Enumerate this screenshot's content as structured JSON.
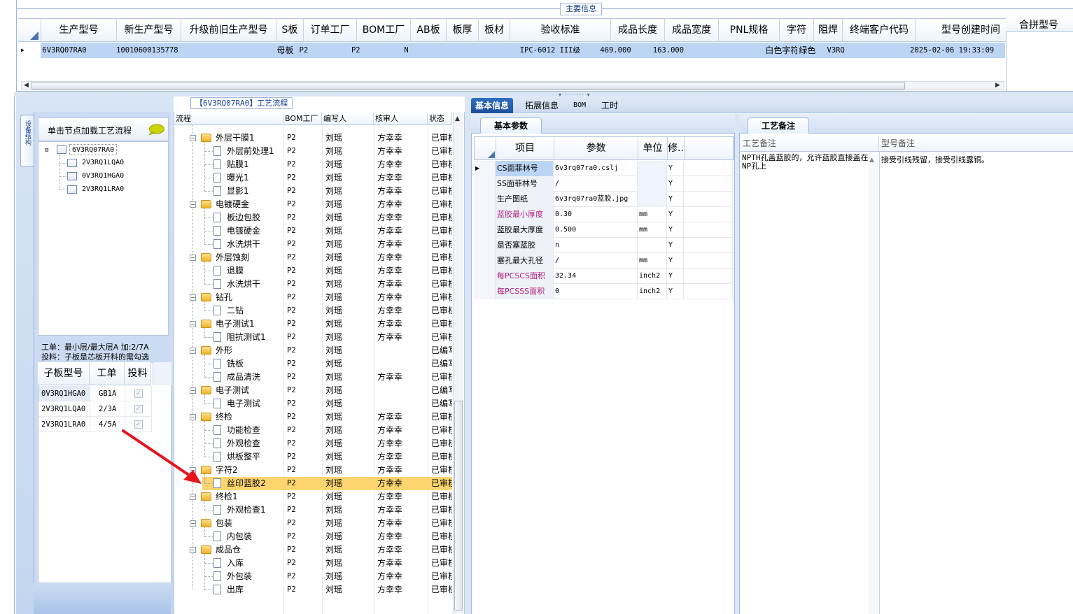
{
  "top": {
    "title": "主要信息",
    "columns": [
      "生产型号",
      "新生产型号",
      "升级前旧生产型号",
      "S板",
      "订单工厂",
      "BOM工厂",
      "AB板",
      "板厚",
      "板材",
      "验收标准",
      "成品长度",
      "成品宽度",
      "PNL规格",
      "字符",
      "阻焊",
      "终端客户代码",
      "型号创建时间"
    ],
    "merge_column": "合拼型号",
    "row": [
      "6V3RQ07RA0",
      "10010600135778",
      "",
      "母板",
      "P2",
      "P2",
      "N",
      "",
      "",
      "IPC-6012 III级",
      "469.000",
      "163.000",
      "",
      "白色字符",
      "绿色",
      "V3RQ",
      "2025-02-06 19:33:09"
    ]
  },
  "left": {
    "vtab_label": "设备结构",
    "tip": "单击节点加载工艺流程",
    "tree_root": "6V3RQ07RA0",
    "tree_children": [
      "2V3RQ1LQA0",
      "0V3RQ1HGA0",
      "2V3RQ1LRA0"
    ],
    "info_line1": "工单：最小层/最大层A 加:2/7A",
    "info_line2": "投料：子板是芯板开料的需勾选",
    "sub_columns": [
      "子板型号",
      "工单",
      "投料"
    ],
    "sub_rows": [
      {
        "model": "0V3RQ1HGA0",
        "order": "GB1A"
      },
      {
        "model": "2V3RQ1LQA0",
        "order": "2/3A"
      },
      {
        "model": "2V3RQ1LRA0",
        "order": "4/5A"
      }
    ]
  },
  "flow": {
    "title": "【6V3RQ07RA0】工艺流程",
    "columns": [
      "流程",
      "BOM工厂",
      "编写人",
      "核审人",
      "状态"
    ],
    "rows": [
      {
        "name": "外层干膜1",
        "level": 1,
        "factory": "P2",
        "writer": "刘瑶",
        "reviewer": "方幸幸",
        "status": "已审核"
      },
      {
        "name": "外层前处理1",
        "level": 2,
        "factory": "P2",
        "writer": "刘瑶",
        "reviewer": "方幸幸",
        "status": "已审核"
      },
      {
        "name": "贴膜1",
        "level": 2,
        "factory": "P2",
        "writer": "刘瑶",
        "reviewer": "方幸幸",
        "status": "已审核"
      },
      {
        "name": "曝光1",
        "level": 2,
        "factory": "P2",
        "writer": "刘瑶",
        "reviewer": "方幸幸",
        "status": "已审核"
      },
      {
        "name": "显影1",
        "level": 2,
        "factory": "P2",
        "writer": "刘瑶",
        "reviewer": "方幸幸",
        "status": "已审核"
      },
      {
        "name": "电镀硬金",
        "level": 1,
        "factory": "P2",
        "writer": "刘瑶",
        "reviewer": "方幸幸",
        "status": "已审核"
      },
      {
        "name": "板边包胶",
        "level": 2,
        "factory": "P2",
        "writer": "刘瑶",
        "reviewer": "方幸幸",
        "status": "已审核"
      },
      {
        "name": "电镀硬金",
        "level": 2,
        "factory": "P2",
        "writer": "刘瑶",
        "reviewer": "方幸幸",
        "status": "已审核"
      },
      {
        "name": "水洗烘干",
        "level": 2,
        "factory": "P2",
        "writer": "刘瑶",
        "reviewer": "方幸幸",
        "status": "已审核"
      },
      {
        "name": "外层蚀刻",
        "level": 1,
        "factory": "P2",
        "writer": "刘瑶",
        "reviewer": "方幸幸",
        "status": "已审核"
      },
      {
        "name": "退膜",
        "level": 2,
        "factory": "P2",
        "writer": "刘瑶",
        "reviewer": "方幸幸",
        "status": "已审核"
      },
      {
        "name": "水洗烘干",
        "level": 2,
        "factory": "P2",
        "writer": "刘瑶",
        "reviewer": "方幸幸",
        "status": "已审核"
      },
      {
        "name": "钻孔",
        "level": 1,
        "factory": "P2",
        "writer": "刘瑶",
        "reviewer": "方幸幸",
        "status": "已审核"
      },
      {
        "name": "二钻",
        "level": 2,
        "factory": "P2",
        "writer": "刘瑶",
        "reviewer": "方幸幸",
        "status": "已审核"
      },
      {
        "name": "电子测试1",
        "level": 1,
        "factory": "P2",
        "writer": "刘瑶",
        "reviewer": "方幸幸",
        "status": "已审核"
      },
      {
        "name": "阻抗测试1",
        "level": 2,
        "factory": "P2",
        "writer": "刘瑶",
        "reviewer": "方幸幸",
        "status": "已审核"
      },
      {
        "name": "外形",
        "level": 1,
        "factory": "P2",
        "writer": "刘瑶",
        "reviewer": "",
        "status": "已编写"
      },
      {
        "name": "铣板",
        "level": 2,
        "factory": "P2",
        "writer": "刘瑶",
        "reviewer": "",
        "status": "已编写"
      },
      {
        "name": "成品清洗",
        "level": 2,
        "factory": "P2",
        "writer": "刘瑶",
        "reviewer": "方幸幸",
        "status": "已审核"
      },
      {
        "name": "电子测试",
        "level": 1,
        "factory": "P2",
        "writer": "刘瑶",
        "reviewer": "",
        "status": "已编写"
      },
      {
        "name": "电子测试",
        "level": 2,
        "factory": "P2",
        "writer": "刘瑶",
        "reviewer": "",
        "status": "已编写"
      },
      {
        "name": "终检",
        "level": 1,
        "factory": "P2",
        "writer": "刘瑶",
        "reviewer": "方幸幸",
        "status": "已审核"
      },
      {
        "name": "功能检查",
        "level": 2,
        "factory": "P2",
        "writer": "刘瑶",
        "reviewer": "方幸幸",
        "status": "已审核"
      },
      {
        "name": "外观检查",
        "level": 2,
        "factory": "P2",
        "writer": "刘瑶",
        "reviewer": "方幸幸",
        "status": "已审核"
      },
      {
        "name": "烘板整平",
        "level": 2,
        "factory": "P2",
        "writer": "刘瑶",
        "reviewer": "方幸幸",
        "status": "已审核"
      },
      {
        "name": "字符2",
        "level": 1,
        "factory": "P2",
        "writer": "刘瑶",
        "reviewer": "方幸幸",
        "status": "已审核"
      },
      {
        "name": "丝印蓝胶2",
        "level": 2,
        "factory": "P2",
        "writer": "刘瑶",
        "reviewer": "方幸幸",
        "status": "已审核",
        "selected": true
      },
      {
        "name": "终检1",
        "level": 1,
        "factory": "P2",
        "writer": "刘瑶",
        "reviewer": "方幸幸",
        "status": "已审核"
      },
      {
        "name": "外观检查1",
        "level": 2,
        "factory": "P2",
        "writer": "刘瑶",
        "reviewer": "方幸幸",
        "status": "已审核"
      },
      {
        "name": "包装",
        "level": 1,
        "factory": "P2",
        "writer": "刘瑶",
        "reviewer": "方幸幸",
        "status": "已审核"
      },
      {
        "name": "内包装",
        "level": 2,
        "factory": "P2",
        "writer": "刘瑶",
        "reviewer": "方幸幸",
        "status": "已审核"
      },
      {
        "name": "成品仓",
        "level": 1,
        "factory": "P2",
        "writer": "刘瑶",
        "reviewer": "方幸幸",
        "status": "已审核"
      },
      {
        "name": "入库",
        "level": 2,
        "factory": "P2",
        "writer": "刘瑶",
        "reviewer": "方幸幸",
        "status": "已审核"
      },
      {
        "name": "外包装",
        "level": 2,
        "factory": "P2",
        "writer": "刘瑶",
        "reviewer": "方幸幸",
        "status": "已审核"
      },
      {
        "name": "出库",
        "level": 2,
        "factory": "P2",
        "writer": "刘瑶",
        "reviewer": "方幸幸",
        "status": "已审核"
      }
    ]
  },
  "right": {
    "tabs": [
      "基本信息",
      "拓展信息",
      "BOM",
      "工时"
    ],
    "basic_tab": "基本参数",
    "param_columns": [
      "项目",
      "参数",
      "单位",
      "修.."
    ],
    "params": [
      {
        "item": "CS面菲林号",
        "value": "6v3rq07ra0.cslj",
        "unit": "",
        "mod": "Y",
        "highlight": false
      },
      {
        "item": "SS面菲林号",
        "value": "/",
        "unit": "",
        "mod": "Y",
        "highlight": false
      },
      {
        "item": "生产图纸",
        "value": "6v3rq07ra0蓝胶.jpg",
        "unit": "",
        "mod": "Y",
        "highlight": false
      },
      {
        "item": "蓝胶最小厚度",
        "value": "0.30",
        "unit": "mm",
        "mod": "Y",
        "highlight": true
      },
      {
        "item": "蓝胶最大厚度",
        "value": "0.500",
        "unit": "mm",
        "mod": "Y",
        "highlight": false
      },
      {
        "item": "是否塞蓝胶",
        "value": "n",
        "unit": "",
        "mod": "Y",
        "highlight": false
      },
      {
        "item": "塞孔最大孔径",
        "value": "/",
        "unit": "mm",
        "mod": "Y",
        "highlight": false
      },
      {
        "item": "每PCSCS面积",
        "value": "32.34",
        "unit": "inch2",
        "mod": "Y",
        "highlight": true
      },
      {
        "item": "每PCSSS面积",
        "value": "0",
        "unit": "inch2",
        "mod": "Y",
        "highlight": true
      }
    ],
    "notes_tab": "工艺备注",
    "notes_columns": [
      "工艺备注",
      "型号备注"
    ],
    "process_note": "NPTH孔盖蓝胶的，允许蓝胶直接盖在NP孔上",
    "model_note": "接受引线残留，接受引线露铜。"
  },
  "colors": {
    "selection": "#bcd5f5",
    "flow_selected": "#fdd56f",
    "highlight_text": "#b0207c",
    "tab_active": "#1d4f9a",
    "arrow": "#e8141c"
  }
}
